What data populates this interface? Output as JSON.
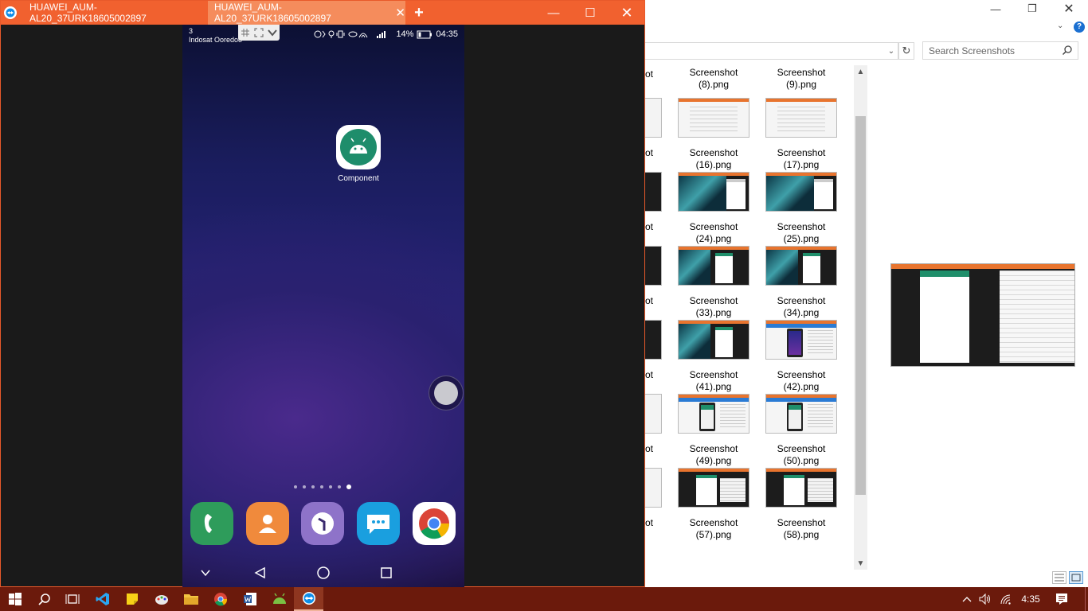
{
  "teamviewer": {
    "tabs": [
      {
        "label": "HUAWEI_AUM-AL20_37URK18605002897"
      },
      {
        "label": "HUAWEI_AUM-AL20_37URK18605002897"
      }
    ],
    "add_tab_label": "+"
  },
  "phone": {
    "status": {
      "carrier_line1": "3",
      "carrier_line2": "Indosat Ooredoo",
      "battery": "14%",
      "time": "04:35"
    },
    "app": {
      "label": "Component"
    },
    "page_count": 7,
    "active_page": 7
  },
  "explorer": {
    "search_placeholder": "Search Screenshots",
    "thumbnails": [
      {
        "name": "Screenshot (8).png",
        "line1": "Screenshot",
        "line2": "(8).png",
        "kind": "blank"
      },
      {
        "name": "Screenshot (9).png",
        "line1": "Screenshot",
        "line2": "(9).png",
        "kind": "blank"
      },
      {
        "name": "Screenshot (16).png",
        "line1": "Screenshot",
        "line2": "(16).png",
        "kind": "doc"
      },
      {
        "name": "Screenshot (17).png",
        "line1": "Screenshot",
        "line2": "(17).png",
        "kind": "doc"
      },
      {
        "name": "Screenshot (24).png",
        "line1": "Screenshot",
        "line2": "(24).png",
        "kind": "img"
      },
      {
        "name": "Screenshot (25).png",
        "line1": "Screenshot",
        "line2": "(25).png",
        "kind": "img"
      },
      {
        "name": "Screenshot (33).png",
        "line1": "Screenshot",
        "line2": "(33).png",
        "kind": "phone"
      },
      {
        "name": "Screenshot (34).png",
        "line1": "Screenshot",
        "line2": "(34).png",
        "kind": "phone"
      },
      {
        "name": "Screenshot (41).png",
        "line1": "Screenshot",
        "line2": "(41).png",
        "kind": "phone"
      },
      {
        "name": "Screenshot (42).png",
        "line1": "Screenshot",
        "line2": "(42).png",
        "kind": "studio"
      },
      {
        "name": "Screenshot (49).png",
        "line1": "Screenshot",
        "line2": "(49).png",
        "kind": "studio-green"
      },
      {
        "name": "Screenshot (50).png",
        "line1": "Screenshot",
        "line2": "(50).png",
        "kind": "studio-green"
      },
      {
        "name": "Screenshot (57).png",
        "line1": "Screenshot",
        "line2": "(57).png",
        "kind": "dark-doc"
      },
      {
        "name": "Screenshot (58).png",
        "line1": "Screenshot",
        "line2": "(58).png",
        "kind": "dark-doc"
      }
    ],
    "partial_caption": "ot"
  },
  "taskbar": {
    "time": "4:35"
  },
  "colors": {
    "teamviewer_orange": "#f1612f",
    "taskbar": "#6b1a0c",
    "android_green": "#1e8d6b"
  }
}
